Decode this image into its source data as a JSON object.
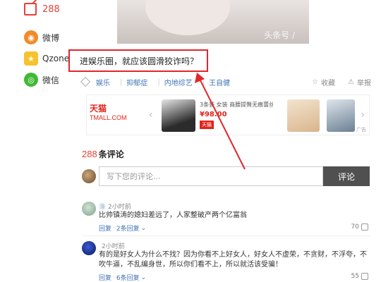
{
  "share": {
    "comment_count": "288",
    "items": [
      {
        "label": "微博",
        "icon": "weibo-icon",
        "color": "#f08b2b"
      },
      {
        "label": "Qzone",
        "icon": "qzone-star-icon",
        "color": "#f7c32d"
      },
      {
        "label": "微信",
        "icon": "wechat-icon",
        "color": "#3fb934"
      }
    ]
  },
  "article": {
    "image_watermark": "头条号 / ",
    "title": "进娱乐圈，就应该圆滑狡诈吗？",
    "highlight_color": "#e0262c"
  },
  "tags": {
    "items": [
      "娱乐",
      "抑郁症",
      "内地综艺",
      "王自健"
    ],
    "collect_label": "收藏",
    "report_label": "举报"
  },
  "ad": {
    "brand_line1": "天猫",
    "brand_line2": "TMALL.COM",
    "product_title": "3条装 女装 商腰提臀无痕蕾丝性",
    "price": "¥98.00",
    "badge": "天猫",
    "ad_label": "广告"
  },
  "comments": {
    "count": "288",
    "header_label": "条评论",
    "input_placeholder": "写下您的评论...",
    "submit_label": "评论",
    "items": [
      {
        "username": "ヨ",
        "time": "2小时前",
        "text": "比帅镇涛的媳妇差远了，人家整破产两个亿富翁",
        "reply_label": "回复",
        "replies_label": "2条回复",
        "likes": "70"
      },
      {
        "username": "",
        "time": "2小时前",
        "text": "有的是好女人为什么不找？因为你看不上好女人，好女人不虚荣，不贪财，不浮夸，不吹牛逼，不乱编身世，所以你们看不上，所以就活该受骗！",
        "reply_label": "回复",
        "replies_label": "6条回复",
        "likes": "55"
      }
    ]
  },
  "colors": {
    "accent_red": "#e8413a",
    "link_blue": "#3f73b4",
    "submit_bg": "#505050"
  }
}
